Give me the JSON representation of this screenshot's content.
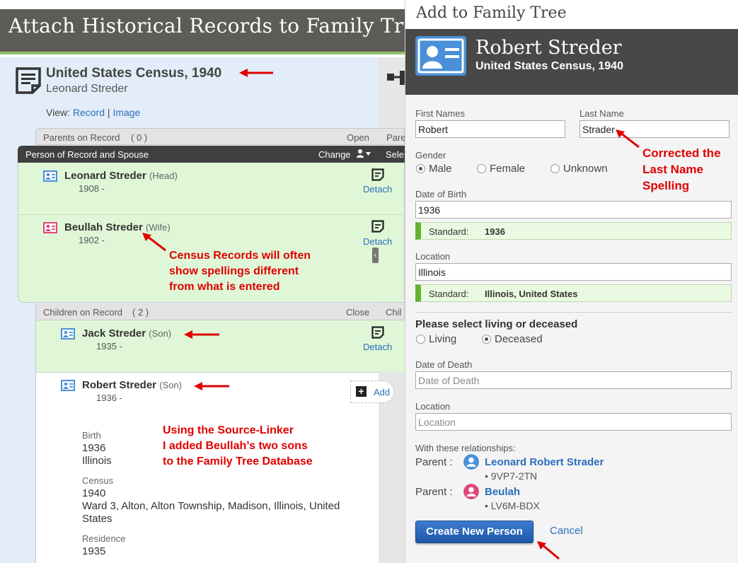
{
  "page": {
    "title": "Attach Historical Records to Family Tree",
    "record_title": "United States Census, 1940",
    "record_person": "Leonard Streder",
    "view_label": "View:",
    "view_record": "Record",
    "view_sep": "|",
    "view_image": "Image"
  },
  "parents_bar": {
    "label": "Parents on Record",
    "count": "( 0 )",
    "toggle": "Open",
    "right_cut": "Pare"
  },
  "person_bar": {
    "label": "Person of Record and Spouse",
    "change": "Change",
    "right_cut": "Sele"
  },
  "persons": [
    {
      "name": "Leonard Streder",
      "role": "(Head)",
      "year": "1908 -",
      "action": "Detach"
    },
    {
      "name": "Beullah Streder",
      "role": "(Wife)",
      "year": "1902 -",
      "action": "Detach"
    }
  ],
  "children_bar": {
    "label": "Children on Record",
    "count": "( 2 )",
    "toggle": "Close",
    "right_cut": "Chil"
  },
  "children": [
    {
      "name": "Jack Streder",
      "role": "(Son)",
      "year": "1935 -",
      "action": "Detach"
    },
    {
      "name": "Robert Streder",
      "role": "(Son)",
      "year": "1936 -",
      "action": "Add"
    }
  ],
  "details": [
    {
      "label": "Birth",
      "lines": [
        "1936",
        "Illinois"
      ]
    },
    {
      "label": "Census",
      "lines": [
        "1940",
        "Ward 3, Alton, Alton Township, Madison, Illinois, United",
        "States"
      ]
    },
    {
      "label": "Residence",
      "lines": [
        "1935"
      ]
    }
  ],
  "annotations": {
    "census": [
      "Census Records will often",
      "show spellings different",
      "from what is entered"
    ],
    "linker": [
      "Using the Source-Linker",
      "I added Beullah’s two sons",
      "to the Family Tree Database"
    ],
    "corrected": [
      "Corrected the",
      "Last Name",
      "Spelling"
    ]
  },
  "panel": {
    "title": "Add to Family Tree",
    "name": "Robert Streder",
    "source": "United States Census, 1940",
    "first_names_label": "First Names",
    "first_names_value": "Robert",
    "last_name_label": "Last Name",
    "last_name_value": "Strader",
    "gender_label": "Gender",
    "gender_options": [
      "Male",
      "Female",
      "Unknown"
    ],
    "gender_selected": "Male",
    "dob_label": "Date of Birth",
    "dob_value": "1936",
    "standard_label": "Standard:",
    "dob_standard": "1936",
    "location_label": "Location",
    "location_value": "Illinois",
    "location_standard": "Illinois, United States",
    "living_prompt": "Please select living or deceased",
    "living_options": [
      "Living",
      "Deceased"
    ],
    "living_selected": "Deceased",
    "dod_label": "Date of Death",
    "dod_placeholder": "Date of Death",
    "death_location_label": "Location",
    "death_location_placeholder": "Location",
    "relationships_label": "With these relationships:",
    "relationships": [
      {
        "role": "Parent :",
        "name": "Leonard Robert Strader",
        "id": "• 9VP7-2TN",
        "gender": "male"
      },
      {
        "role": "Parent :",
        "name": "Beulah",
        "id": "• LV6M-BDX",
        "gender": "female"
      }
    ],
    "create_button": "Create New Person",
    "cancel_link": "Cancel"
  },
  "colors": {
    "male": "#4a90d9",
    "female": "#e0457b",
    "green_accent": "#62b32e",
    "annotation": "#e00000"
  }
}
